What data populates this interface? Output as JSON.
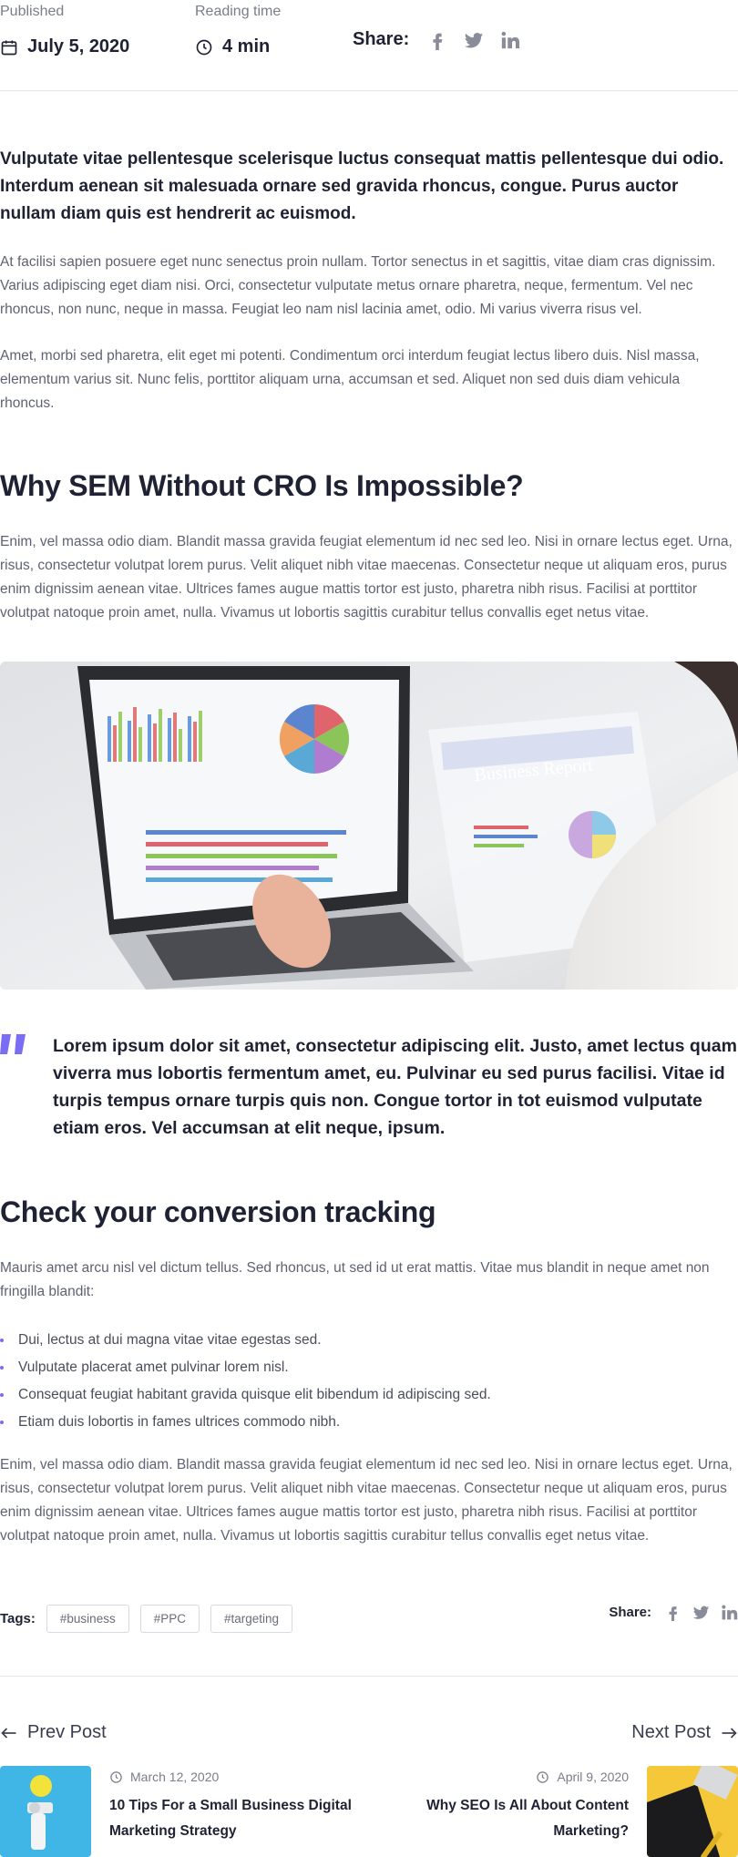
{
  "meta": {
    "published_label": "Published",
    "published_date": "July 5, 2020",
    "reading_label": "Reading time",
    "reading_value": "4 min",
    "share_label": "Share:"
  },
  "article": {
    "lead": "Vulputate vitae pellentesque scelerisque luctus consequat mattis pellentesque dui odio. Interdum aenean sit malesuada ornare sed gravida rhoncus, congue. Purus auctor nullam diam quis est hendrerit ac euismod.",
    "p1": "At facilisi sapien posuere eget nunc senectus proin nullam. Tortor senectus in et sagittis, vitae diam cras dignissim. Varius adipiscing eget diam nisi. Orci, consectetur vulputate metus ornare pharetra, neque, fermentum. Vel nec rhoncus, non nunc, neque in massa. Feugiat leo nam nisl lacinia amet, odio. Mi varius viverra risus vel.",
    "p2": "Amet, morbi sed pharetra, elit eget mi potenti. Condimentum orci interdum feugiat lectus libero duis. Nisl massa, elementum varius sit. Nunc felis, porttitor aliquam urna, accumsan et sed. Aliquet non sed duis diam vehicula rhoncus.",
    "h2_1": "Why SEM Without CRO Is Impossible?",
    "p3": "Enim, vel massa odio diam. Blandit massa gravida feugiat elementum id nec sed leo. Nisi in ornare lectus eget. Urna, risus, consectetur volutpat lorem purus. Velit aliquet nibh vitae maecenas. Consectetur neque ut aliquam eros, purus enim dignissim aenean vitae. Ultrices fames augue mattis tortor est justo, pharetra nibh risus. Facilisi at porttitor volutpat natoque proin amet, nulla. Vivamus ut lobortis sagittis curabitur tellus convallis eget netus vitae.",
    "image_report_text": "Business Report",
    "quote": "Lorem ipsum dolor sit amet, consectetur adipiscing elit. Justo, amet lectus quam viverra mus lobortis fermentum amet, eu. Pulvinar eu sed purus  facilisi. Vitae id turpis tempus ornare turpis quis non. Congue tortor in tot euismod vulputate etiam eros. Vel accumsan at elit neque, ipsum.",
    "h2_2": "Check your conversion tracking",
    "p4": "Mauris amet arcu nisl vel dictum tellus. Sed rhoncus, ut sed id ut erat mattis. Vitae mus blandit in neque amet non fringilla blandit:",
    "bullets": [
      "Dui, lectus at dui magna vitae vitae egestas sed.",
      "Vulputate placerat amet pulvinar lorem nisl.",
      "Consequat feugiat habitant gravida quisque elit bibendum id adipiscing sed.",
      "Etiam duis lobortis in fames ultrices commodo nibh."
    ],
    "p5": "Enim, vel massa odio diam. Blandit massa gravida feugiat elementum id nec sed leo. Nisi in ornare lectus eget. Urna, risus, consectetur volutpat lorem purus. Velit aliquet nibh vitae maecenas. Consectetur neque ut aliquam eros, purus enim dignissim aenean vitae. Ultrices fames augue mattis tortor est justo, pharetra nibh risus. Facilisi at porttitor volutpat natoque proin amet, nulla. Vivamus ut lobortis sagittis curabitur tellus convallis eget netus vitae."
  },
  "tags": {
    "label": "Tags:",
    "items": [
      "#business",
      "#PPC",
      "#targeting"
    ],
    "share_label": "Share:"
  },
  "nav": {
    "prev_label": "Prev Post",
    "next_label": "Next Post",
    "prev_post": {
      "date": "March 12, 2020",
      "title": "10 Tips For a Small Business Digital Marketing Strategy"
    },
    "next_post": {
      "date": "April 9, 2020",
      "title": "Why SEO Is All About Content Marketing?"
    }
  },
  "icons": {
    "calendar": "calendar-icon",
    "clock": "clock-icon",
    "facebook": "facebook-icon",
    "twitter": "twitter-icon",
    "linkedin": "linkedin-icon",
    "quote": "quote-icon",
    "arrow_left": "arrow-left-icon",
    "arrow_right": "arrow-right-icon"
  },
  "colors": {
    "accent": "#7b6cf6",
    "heading": "#1f2233",
    "body_text": "#5f6272",
    "muted": "#7a7d8a"
  }
}
